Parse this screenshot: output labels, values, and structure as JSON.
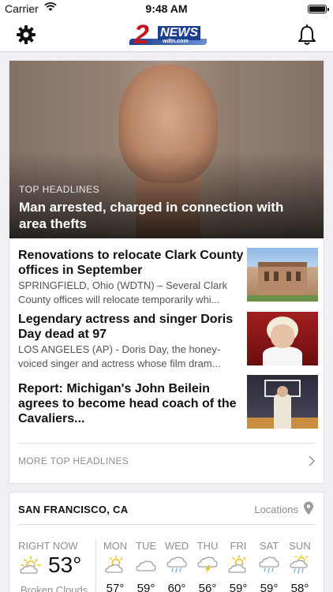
{
  "status_bar": {
    "carrier": "Carrier",
    "time": "9:48 AM"
  },
  "nav": {
    "logo_number": "2",
    "logo_text": "NEWS",
    "logo_site": "wdtn.com"
  },
  "top_story": {
    "kicker": "TOP HEADLINES",
    "title": "Man arrested, charged in connection with area thefts"
  },
  "stories": [
    {
      "title": "Renovations to relocate Clark County offices in September",
      "summary": "SPRINGFIELD, Ohio (WDTN) – Several Clark County offices will relocate temporarily whi..."
    },
    {
      "title": "Legendary actress and singer Doris Day dead at 97",
      "summary": "LOS ANGELES (AP) - Doris Day, the honey-voiced singer and actress whose film dram..."
    },
    {
      "title": "Report: Michigan's John Beilein agrees to become head coach of the Cavaliers...",
      "summary": ""
    }
  ],
  "more_link": "MORE TOP HEADLINES",
  "weather": {
    "location": "SAN FRANCISCO, CA",
    "locations_label": "Locations",
    "now_label": "RIGHT NOW",
    "now_temp": "53°",
    "now_condition": "Broken Clouds",
    "days": [
      {
        "name": "MON",
        "icon": "partly-sunny-icon",
        "hi": "57°"
      },
      {
        "name": "TUE",
        "icon": "cloud-icon",
        "hi": "59°"
      },
      {
        "name": "WED",
        "icon": "rain-cloud-icon",
        "hi": "60°"
      },
      {
        "name": "THU",
        "icon": "thunderstorm-icon",
        "hi": "56°"
      },
      {
        "name": "FRI",
        "icon": "partly-sunny-icon",
        "hi": "59°"
      },
      {
        "name": "SAT",
        "icon": "rain-cloud-icon",
        "hi": "59°"
      },
      {
        "name": "SUN",
        "icon": "sun-rain-icon",
        "hi": "58°"
      }
    ]
  },
  "colors": {
    "brand_red": "#c4161c",
    "brand_blue": "#1c3f8f",
    "accent_yellow": "#f2c21b",
    "accent_blue": "#7db9e0"
  }
}
